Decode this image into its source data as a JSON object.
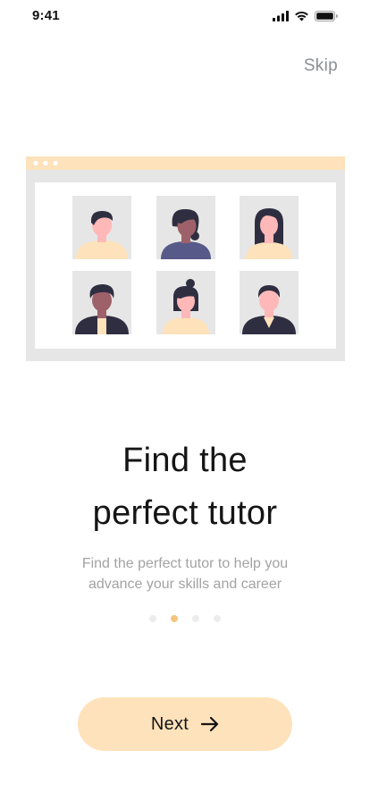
{
  "status_bar": {
    "time": "9:41",
    "icons": [
      "cellular-signal-icon",
      "wifi-icon",
      "battery-icon"
    ]
  },
  "header": {
    "skip_label": "Skip"
  },
  "illustration": {
    "name": "tutor-video-grid",
    "tiles": 6,
    "colors": {
      "window_bar": "#fde2bb",
      "frame": "#e6e6e6",
      "tile_bg": "#e6e6e6",
      "skin": "#ffb8b8",
      "hair": "#2f2e41",
      "shirt_yellow": "#fde2bb",
      "shirt_purple": "#575a89",
      "shirt_dark": "#2f2e41"
    }
  },
  "onboarding": {
    "title_line1": "Find the",
    "title_line2": "perfect tutor",
    "subtitle_line1": "Find the perfect tutor to help you",
    "subtitle_line2": "advance your skills and career",
    "page_count": 4,
    "active_page": 2
  },
  "cta": {
    "next_label": "Next",
    "icon": "arrow-right-icon"
  },
  "colors": {
    "accent": "#f4c47e",
    "button_bg": "#fde2bb",
    "title": "#151515",
    "subtitle": "#a3a3a3",
    "skip": "#8a8f93"
  }
}
